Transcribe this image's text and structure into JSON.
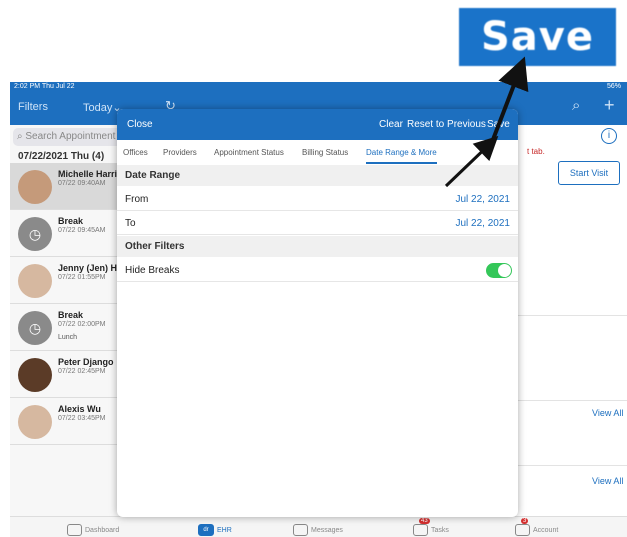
{
  "zoom_label": "Save",
  "status": {
    "time": "2:02 PM  Thu Jul 22",
    "battery": "56%"
  },
  "nav": {
    "filters": "Filters",
    "today": "Today",
    "refresh_icon": "refresh-icon",
    "search_icon": "search-icon",
    "add_icon": "+"
  },
  "sidebar": {
    "search_placeholder": "Search Appointment",
    "date_header": "07/22/2021 Thu (4)",
    "appointments": [
      {
        "name": "Michelle Harris",
        "time": "07/22 09:40AM",
        "note": ""
      },
      {
        "name": "Break",
        "time": "07/22 09:45AM",
        "note": ""
      },
      {
        "name": "Jenny (Jen) Hi",
        "time": "07/22 01:55PM",
        "note": ""
      },
      {
        "name": "Break",
        "time": "07/22 02:00PM",
        "note": "Lunch"
      },
      {
        "name": "Peter Django",
        "time": "07/22 02:45PM",
        "note": ""
      },
      {
        "name": "Alexis Wu",
        "time": "07/22 03:45PM",
        "note": ""
      }
    ]
  },
  "main": {
    "red_text": "t tab.",
    "start_visit": "Start Visit",
    "view_all_1": "View All",
    "view_all_2": "View All"
  },
  "modal": {
    "close": "Close",
    "clear": "Clear",
    "reset": "Reset to Previous",
    "save": "Save",
    "tabs": [
      "Offices",
      "Providers",
      "Appointment Status",
      "Billing Status",
      "Date Range & More"
    ],
    "active_tab": "Date Range & More",
    "date_range_title": "Date Range",
    "from_label": "From",
    "from_value": "Jul 22, 2021",
    "to_label": "To",
    "to_value": "Jul 22, 2021",
    "other_filters_title": "Other Filters",
    "hide_breaks_label": "Hide Breaks",
    "hide_breaks_on": true
  },
  "tabbar": {
    "dashboard": "Dashboard",
    "ehr": "EHR",
    "ehr_icon_text": "dr",
    "messages": "Messages",
    "tasks": "Tasks",
    "tasks_badge": "43",
    "account": "Account",
    "account_badge": "3"
  },
  "colors": {
    "brand_blue": "#1d6fbf",
    "toggle_green": "#34c759",
    "badge_red": "#d32f2f"
  }
}
